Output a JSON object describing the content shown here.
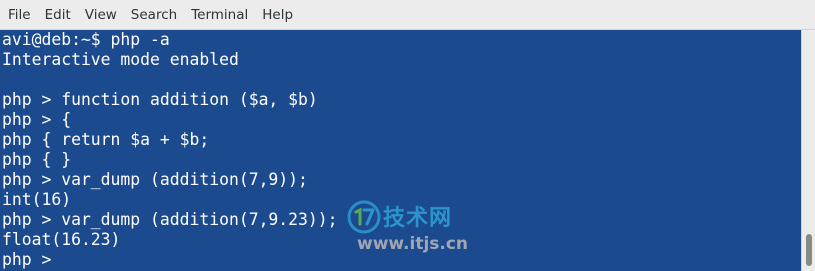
{
  "menubar": {
    "items": [
      {
        "label": "File"
      },
      {
        "label": "Edit"
      },
      {
        "label": "View"
      },
      {
        "label": "Search"
      },
      {
        "label": "Terminal"
      },
      {
        "label": "Help"
      }
    ]
  },
  "terminal": {
    "lines": [
      {
        "text": "avi@deb:~$ php -a"
      },
      {
        "text": "Interactive mode enabled"
      },
      {
        "text": ""
      },
      {
        "text": "php > function addition ($a, $b)"
      },
      {
        "text": "php > {"
      },
      {
        "text": "php { return $a + $b;"
      },
      {
        "text": "php { }"
      },
      {
        "text": "php > var_dump (addition(7,9));"
      },
      {
        "text": "int(16)"
      },
      {
        "text": "php > var_dump (addition(7,9.23));"
      },
      {
        "text": "float(16.23)"
      },
      {
        "text": "php > "
      }
    ],
    "colors": {
      "background": "#1c4a8f",
      "foreground": "#ffffff"
    }
  },
  "watermark": {
    "logo_icon": "17-logo-icon",
    "title": "技术网",
    "url": "www.itjs.cn",
    "colors": {
      "title": "#2fa2d8",
      "url": "#b7b7b7"
    }
  },
  "scrollbar": {
    "position_fraction": 0.95
  }
}
